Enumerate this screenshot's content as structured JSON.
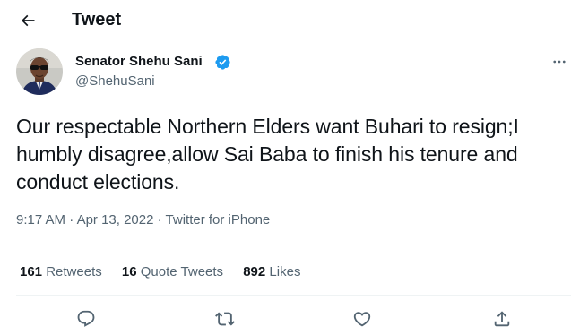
{
  "header": {
    "title": "Tweet",
    "back_icon": "arrow-left-icon"
  },
  "author": {
    "display_name": "Senator Shehu Sani",
    "handle": "@ShehuSani",
    "verified": true,
    "verified_icon": "verified-badge-icon"
  },
  "tweet": {
    "text": "Our respectable Northern Elders want Buhari to resign;I humbly disagree,allow Sai Baba to finish his tenure and conduct elections.",
    "time": "9:17 AM",
    "date": "Apr 13, 2022",
    "separator": "·",
    "source": "Twitter for iPhone"
  },
  "stats": {
    "retweets_count": "161",
    "retweets_label": "Retweets",
    "quotes_count": "16",
    "quotes_label": "Quote Tweets",
    "likes_count": "892",
    "likes_label": "Likes"
  },
  "actions": [
    "reply-icon",
    "retweet-icon",
    "like-icon",
    "share-icon"
  ],
  "colors": {
    "text": "#0f1419",
    "secondary": "#536471",
    "divider": "#eff3f4",
    "verified": "#1d9bf0"
  }
}
